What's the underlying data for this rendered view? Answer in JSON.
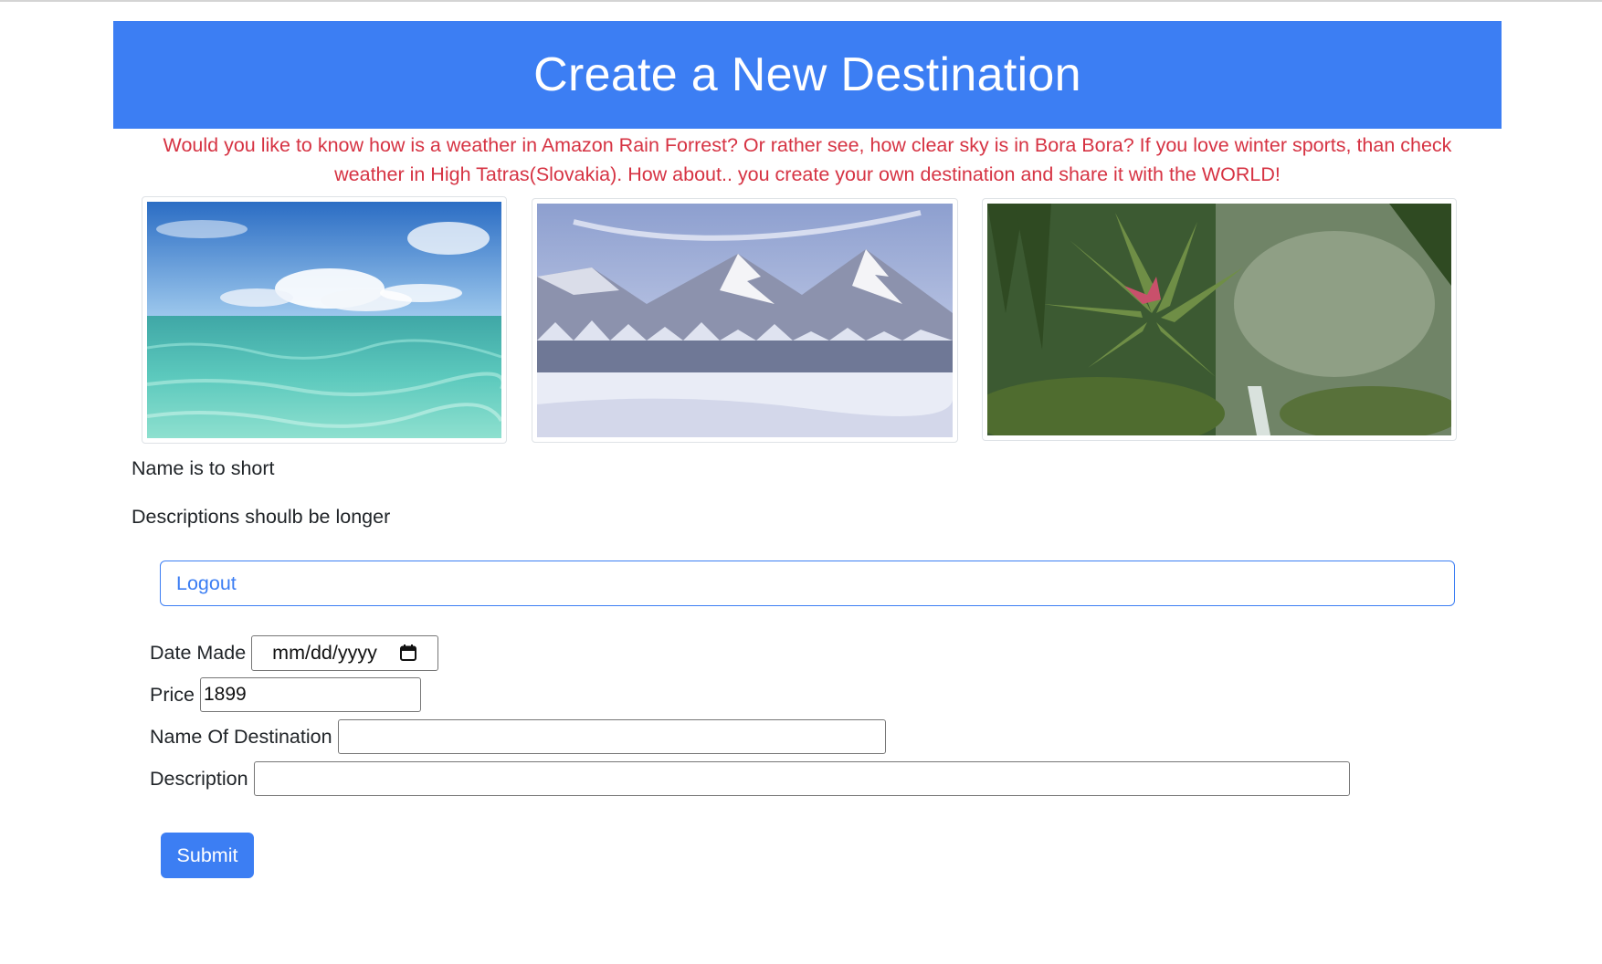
{
  "header": {
    "title": "Create a New Destination"
  },
  "intro": "Would you like to know how is a weather in Amazon Rain Forrest? Or rather see, how clear sky is in Bora Bora? If you love winter sports, than check weather in High Tatras(Slovakia). How about.. you create your own destination and share it with the WORLD!",
  "images": [
    {
      "subject": "ocean-lagoon"
    },
    {
      "subject": "snowy-mountains"
    },
    {
      "subject": "rainforest"
    }
  ],
  "validation": {
    "name_error": "Name is to short",
    "description_error": "Descriptions shoulb be longer"
  },
  "logout_label": "Logout",
  "form": {
    "date_label": "Date Made",
    "date_placeholder": "mm/dd/yyyy",
    "price_label": "Price",
    "price_value": "1899",
    "name_label": "Name Of Destination",
    "name_value": "",
    "description_label": "Description",
    "description_value": "",
    "submit_label": "Submit"
  },
  "colors": {
    "primary": "#3c7ef3",
    "danger": "#d63343",
    "text": "#212529"
  }
}
